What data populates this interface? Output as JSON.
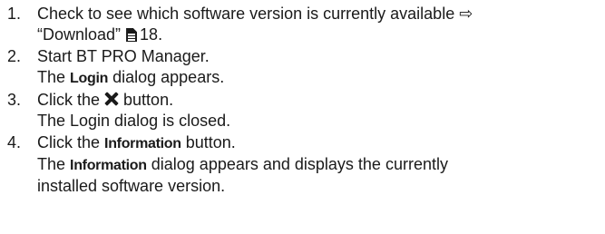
{
  "steps": [
    {
      "number": "1.",
      "line1": "Check to see which software version is currently available",
      "arrow": "⇨",
      "quote": "“Download”",
      "page_ref": "18."
    },
    {
      "number": "2.",
      "action": "Start BT PRO Manager.",
      "result_pre": "The",
      "result_ui": "Login",
      "result_post": "dialog appears."
    },
    {
      "number": "3.",
      "action_pre": "Click the",
      "action_post": "button.",
      "result": "The Login dialog is closed."
    },
    {
      "number": "4.",
      "action_pre": "Click the",
      "action_ui": "Information",
      "action_post": "button.",
      "result_pre": "The",
      "result_ui": "Information",
      "result_post": "dialog appears and displays the currently",
      "result_line2": "installed software version."
    }
  ]
}
